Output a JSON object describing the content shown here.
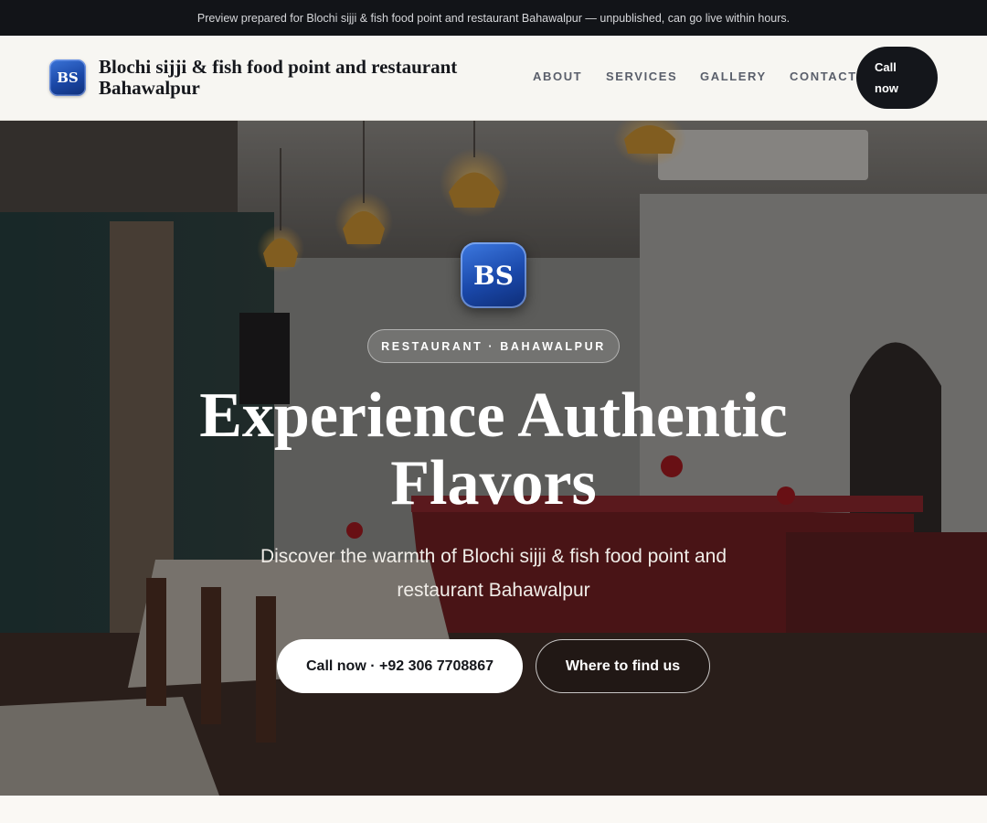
{
  "preview_bar": {
    "text": "Preview prepared for Blochi sijji & fish food point and restaurant Bahawalpur — unpublished, can go live within hours."
  },
  "header": {
    "logo_initials": "BS",
    "brand_name": "Blochi sijji & fish food point and restaurant Bahawalpur",
    "nav": [
      "ABOUT",
      "SERVICES",
      "GALLERY",
      "CONTACT"
    ],
    "call_button": "Call now"
  },
  "hero": {
    "logo_initials": "BS",
    "pill": "RESTAURANT · BAHAWALPUR",
    "title": "Experience Authentic Flavors",
    "subtitle": "Discover the warmth of Blochi sijji & fish food point and restaurant Bahawalpur",
    "primary_button": "Call now · +92 306 7708867",
    "secondary_button": "Where to find us"
  },
  "colors": {
    "preview_bar_bg": "#121418",
    "header_bg": "#f7f6f2",
    "logo_blue": "#1a47a6",
    "dark_button": "#14161b",
    "hero_overlay": "#0c0a0a"
  }
}
